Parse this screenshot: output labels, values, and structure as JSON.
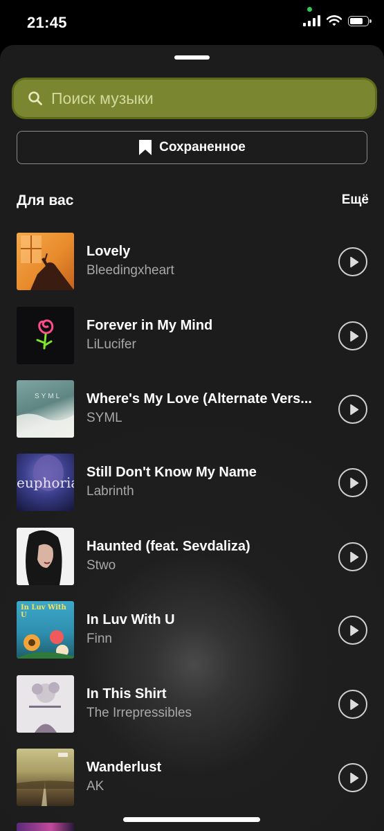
{
  "status_bar": {
    "time": "21:45"
  },
  "search": {
    "placeholder": "Поиск музыки"
  },
  "saved": {
    "label": "Сохраненное"
  },
  "section": {
    "title": "Для вас",
    "more": "Ещё"
  },
  "tracks": [
    {
      "title": "Lovely",
      "artist": "Bleedingxheart"
    },
    {
      "title": "Forever in My Mind",
      "artist": "LiLucifer"
    },
    {
      "title": "Where's My Love (Alternate Vers...",
      "artist": "SYML",
      "cover_text": "SYML"
    },
    {
      "title": "Still Don't Know My Name",
      "artist": "Labrinth",
      "cover_text": "euphoria"
    },
    {
      "title": "Haunted (feat. Sevdaliza)",
      "artist": "Stwo"
    },
    {
      "title": "In Luv With U",
      "artist": "Finn",
      "cover_text": "In Luv With U"
    },
    {
      "title": "In This Shirt",
      "artist": "The Irrepressibles"
    },
    {
      "title": "Wanderlust",
      "artist": "AK"
    }
  ],
  "colors": {
    "search_bg": "#7b8730",
    "search_text": "#d2d99a",
    "background": "#1c1c1c"
  }
}
